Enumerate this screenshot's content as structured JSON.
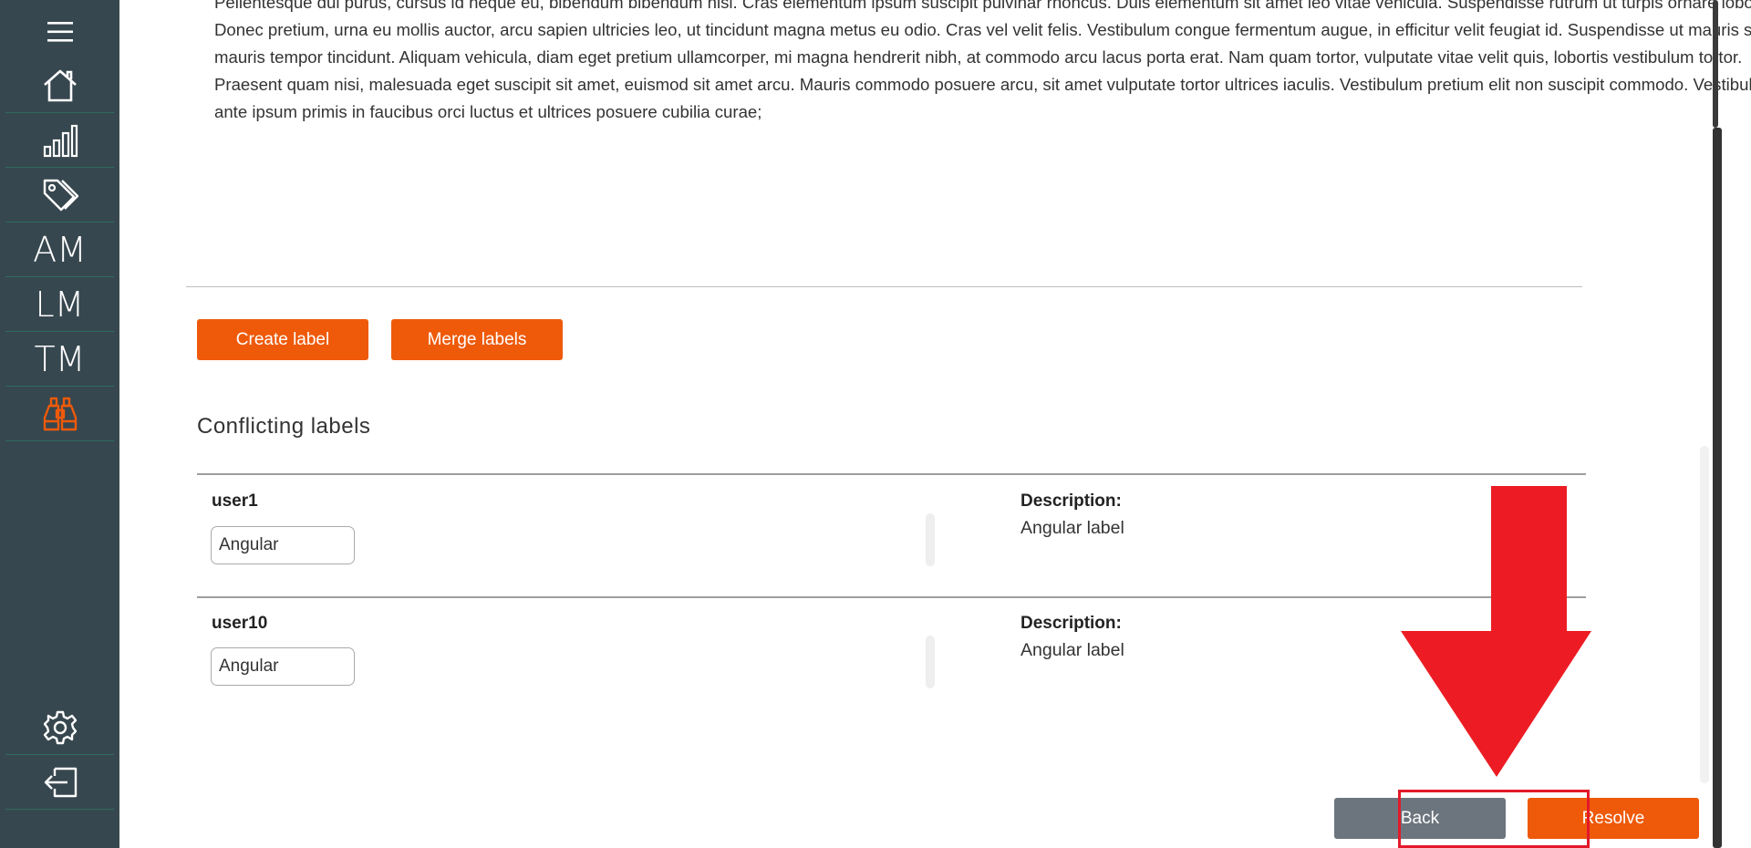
{
  "sidebar": {
    "menu_icon": "hamburger-icon",
    "items": [
      {
        "icon": "home-icon"
      },
      {
        "icon": "bar-chart-icon"
      },
      {
        "icon": "tags-icon"
      },
      {
        "label": "AM"
      },
      {
        "label": "LM"
      },
      {
        "label": "TM"
      },
      {
        "icon": "binoculars-icon",
        "active": true
      }
    ],
    "bottom": [
      {
        "icon": "gear-icon"
      },
      {
        "icon": "logout-icon"
      }
    ],
    "accent_color": "#ee5a0a"
  },
  "main": {
    "paragraph": "Pellentesque dui purus, cursus id neque eu, bibendum bibendum nisi. Cras elementum ipsum suscipit pulvinar rhoncus. Duis elementum sit amet leo vitae vehicula. Suspendisse rutrum ut turpis ornare lobortis. Donec pretium, urna eu mollis auctor, arcu sapien ultricies leo, ut tincidunt magna metus eu odio. Cras vel velit felis. Vestibulum congue fermentum augue, in efficitur velit feugiat id. Suspendisse ut mauris sed mauris tempor tincidunt. Aliquam vehicula, diam eget pretium ullamcorper, mi magna hendrerit nibh, at commodo arcu lacus porta erat. Nam quam tortor, vulputate vitae velit quis, lobortis vestibulum tortor. Praesent quam nisi, malesuada eget suscipit sit amet, euismod sit amet arcu. Mauris commodo posuere arcu, sit amet vulputate tortor ultrices iaculis. Vestibulum pretium elit non suscipit commodo. Vestibulum ante ipsum primis in faucibus orci luctus et ultrices posuere cubilia curae;",
    "buttons": {
      "create_label": "Create label",
      "merge_labels": "Merge labels"
    },
    "conflicting": {
      "title": "Conflicting labels",
      "rows": [
        {
          "user": "user1",
          "value": "Angular",
          "desc_title": "Description:",
          "desc": "Angular label"
        },
        {
          "user": "user10",
          "value": "Angular",
          "desc_title": "Description:",
          "desc": "Angular label"
        }
      ]
    },
    "footer": {
      "back_label": "Back",
      "resolve_label": "Resolve"
    }
  },
  "annotation": {
    "arrow_color": "#ed1c24"
  }
}
